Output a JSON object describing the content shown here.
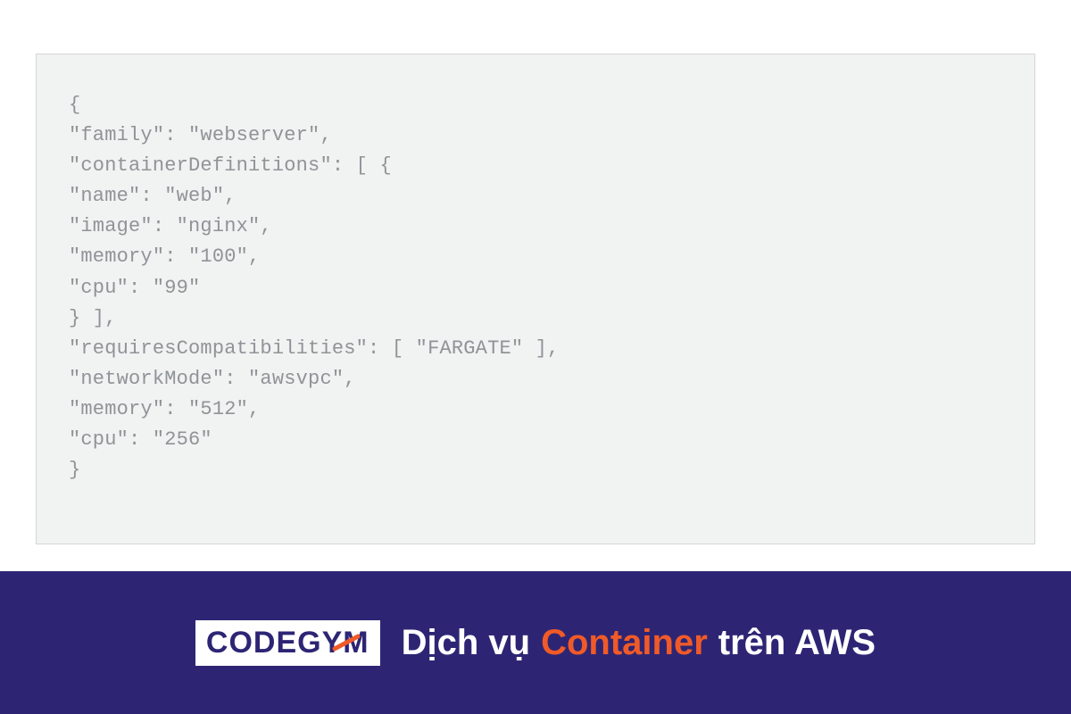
{
  "code": {
    "lines": [
      "{",
      "\"family\": \"webserver\",",
      "\"containerDefinitions\": [ {",
      "\"name\": \"web\",",
      "\"image\": \"nginx\",",
      "\"memory\": \"100\",",
      "\"cpu\": \"99\"",
      "} ],",
      "\"requiresCompatibilities\": [ \"FARGATE\" ],",
      "\"networkMode\": \"awsvpc\",",
      "\"memory\": \"512\",",
      "\"cpu\": \"256\"",
      "}"
    ]
  },
  "logo": {
    "text": "CODEGYM"
  },
  "tagline": {
    "part1": "Dịch vụ",
    "accent": "Container",
    "part2": "trên AWS"
  }
}
